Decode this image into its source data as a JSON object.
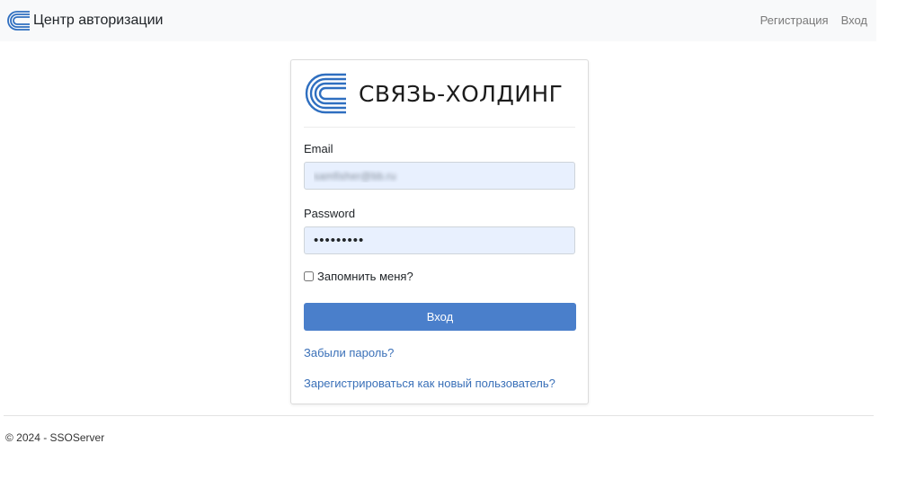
{
  "navbar": {
    "logo_icon": "svyaz-holding-arc-icon",
    "brand_text": "Центр авторизации",
    "links": [
      {
        "label": "Регистрация"
      },
      {
        "label": "Вход"
      }
    ]
  },
  "card": {
    "logo_icon": "svyaz-holding-arc-icon",
    "logo_text": "СВЯЗЬ-ХОЛДИНГ",
    "email": {
      "label": "Email",
      "value": "samfisher@bb.ru"
    },
    "password": {
      "label": "Password",
      "masked_value": "•••••••••"
    },
    "remember": {
      "label": "Запомнить меня?",
      "checked": false
    },
    "submit_label": "Вход",
    "forgot_link": "Забыли пароль?",
    "register_link": "Зарегистрироваться как новый пользователь?"
  },
  "footer": {
    "text": "© 2024 - SSOServer"
  },
  "colors": {
    "accent": "#4a7fcb",
    "link": "#3a70b8",
    "input_autofill_bg": "#e8f0fe",
    "navbar_bg": "#f8f9fa"
  }
}
